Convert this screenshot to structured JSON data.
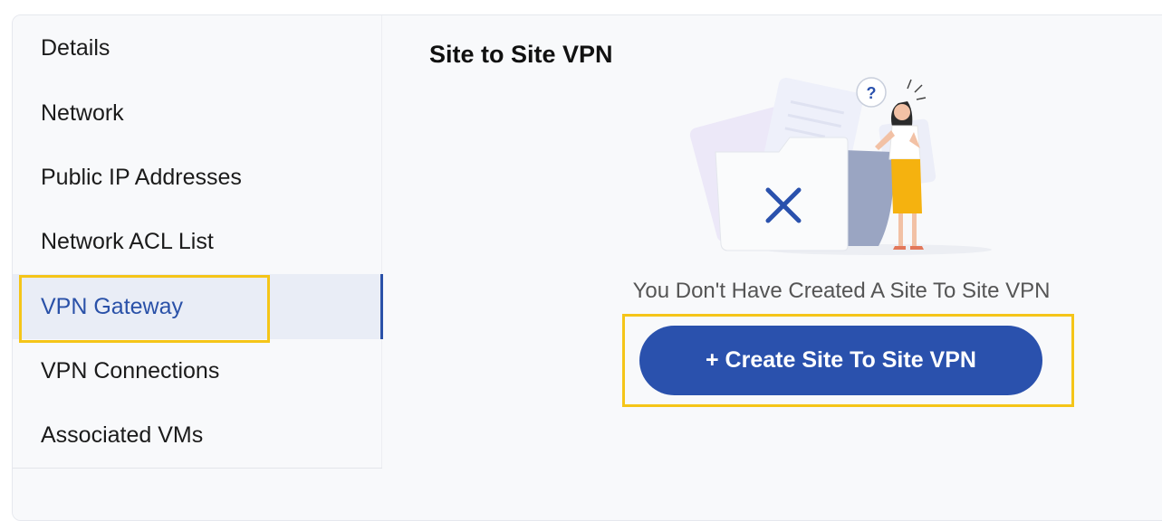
{
  "sidebar": {
    "items": [
      {
        "label": "Details"
      },
      {
        "label": "Network"
      },
      {
        "label": "Public IP Addresses"
      },
      {
        "label": "Network ACL List"
      },
      {
        "label": "VPN Gateway"
      },
      {
        "label": "VPN Connections"
      },
      {
        "label": "Associated VMs"
      }
    ],
    "active": "VPN Gateway"
  },
  "main": {
    "title": "Site to Site VPN",
    "empty_message": "You Don't Have Created A Site To Site VPN",
    "create_button_label": "+ Create Site To Site VPN",
    "illustration": {
      "question_mark": "?",
      "icon": "x-icon"
    }
  },
  "colors": {
    "accent": "#2a51ad",
    "highlight": "#f5c518",
    "active_bg": "#e9edf6"
  }
}
